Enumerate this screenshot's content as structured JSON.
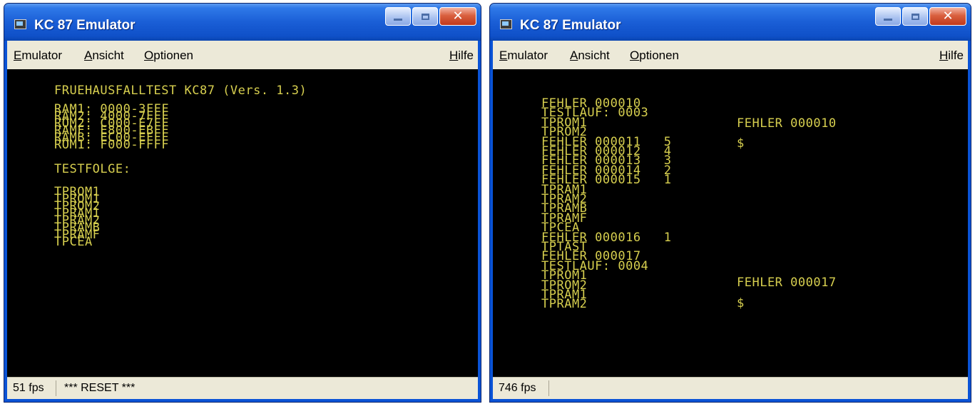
{
  "windows": [
    {
      "title": "KC 87 Emulator",
      "menu": [
        "Emulator",
        "Ansicht",
        "Optionen"
      ],
      "help": "Hilfe",
      "screen_lines": [
        "FRUEHAUSFALLTEST KC87 (Vers. 1.3)",
        "RAM1: 0000-3FFF",
        "RAM2: 4000-7FFF",
        "ROM2: C000-E7FF",
        "RAMF: E800-EBFF",
        "RAMB: EC00-EFFF",
        "ROM1: F000-FFFF",
        "TESTFOLGE:",
        "TPROM1",
        "TPROM1",
        "TPROM2",
        "TPRAM1",
        "TPRAM2",
        "TPRAMB",
        "TPRAMF",
        "TPCEA"
      ],
      "status": {
        "fps": "51 fps",
        "message": "*** RESET ***"
      }
    },
    {
      "title": "KC 87 Emulator",
      "menu": [
        "Emulator",
        "Ansicht",
        "Optionen"
      ],
      "help": "Hilfe",
      "screen_lines": [
        "FEHLER 000010",
        "TESTLAUF: 0003",
        "TPROM1",
        "TPROM2",
        "FEHLER 000011   5",
        "FEHLER 000012   4",
        "FEHLER 000013   3",
        "FEHLER 000014   2",
        "FEHLER 000015   1",
        "TPRAM1",
        "TPRAM2",
        "TPRAMB",
        "TPRAMF",
        "TPCEA",
        "FEHLER 000016   1",
        "TPTAST",
        "FEHLER 000017",
        "TESTLAUF: 0004",
        "TPROM1",
        "TPROM2",
        "TPRAM1",
        "TPRAM2"
      ],
      "side_lines": [
        "FEHLER 000010",
        "$",
        "FEHLER 000017",
        "$"
      ],
      "status": {
        "fps": "746 fps",
        "message": ""
      }
    }
  ],
  "colors": {
    "screen_text": "#d7cf4f",
    "screen_bg": "#000000",
    "titlebar": "#1a5ed6"
  },
  "icons": [
    "app-icon",
    "minimize-icon",
    "maximize-icon",
    "close-icon"
  ]
}
